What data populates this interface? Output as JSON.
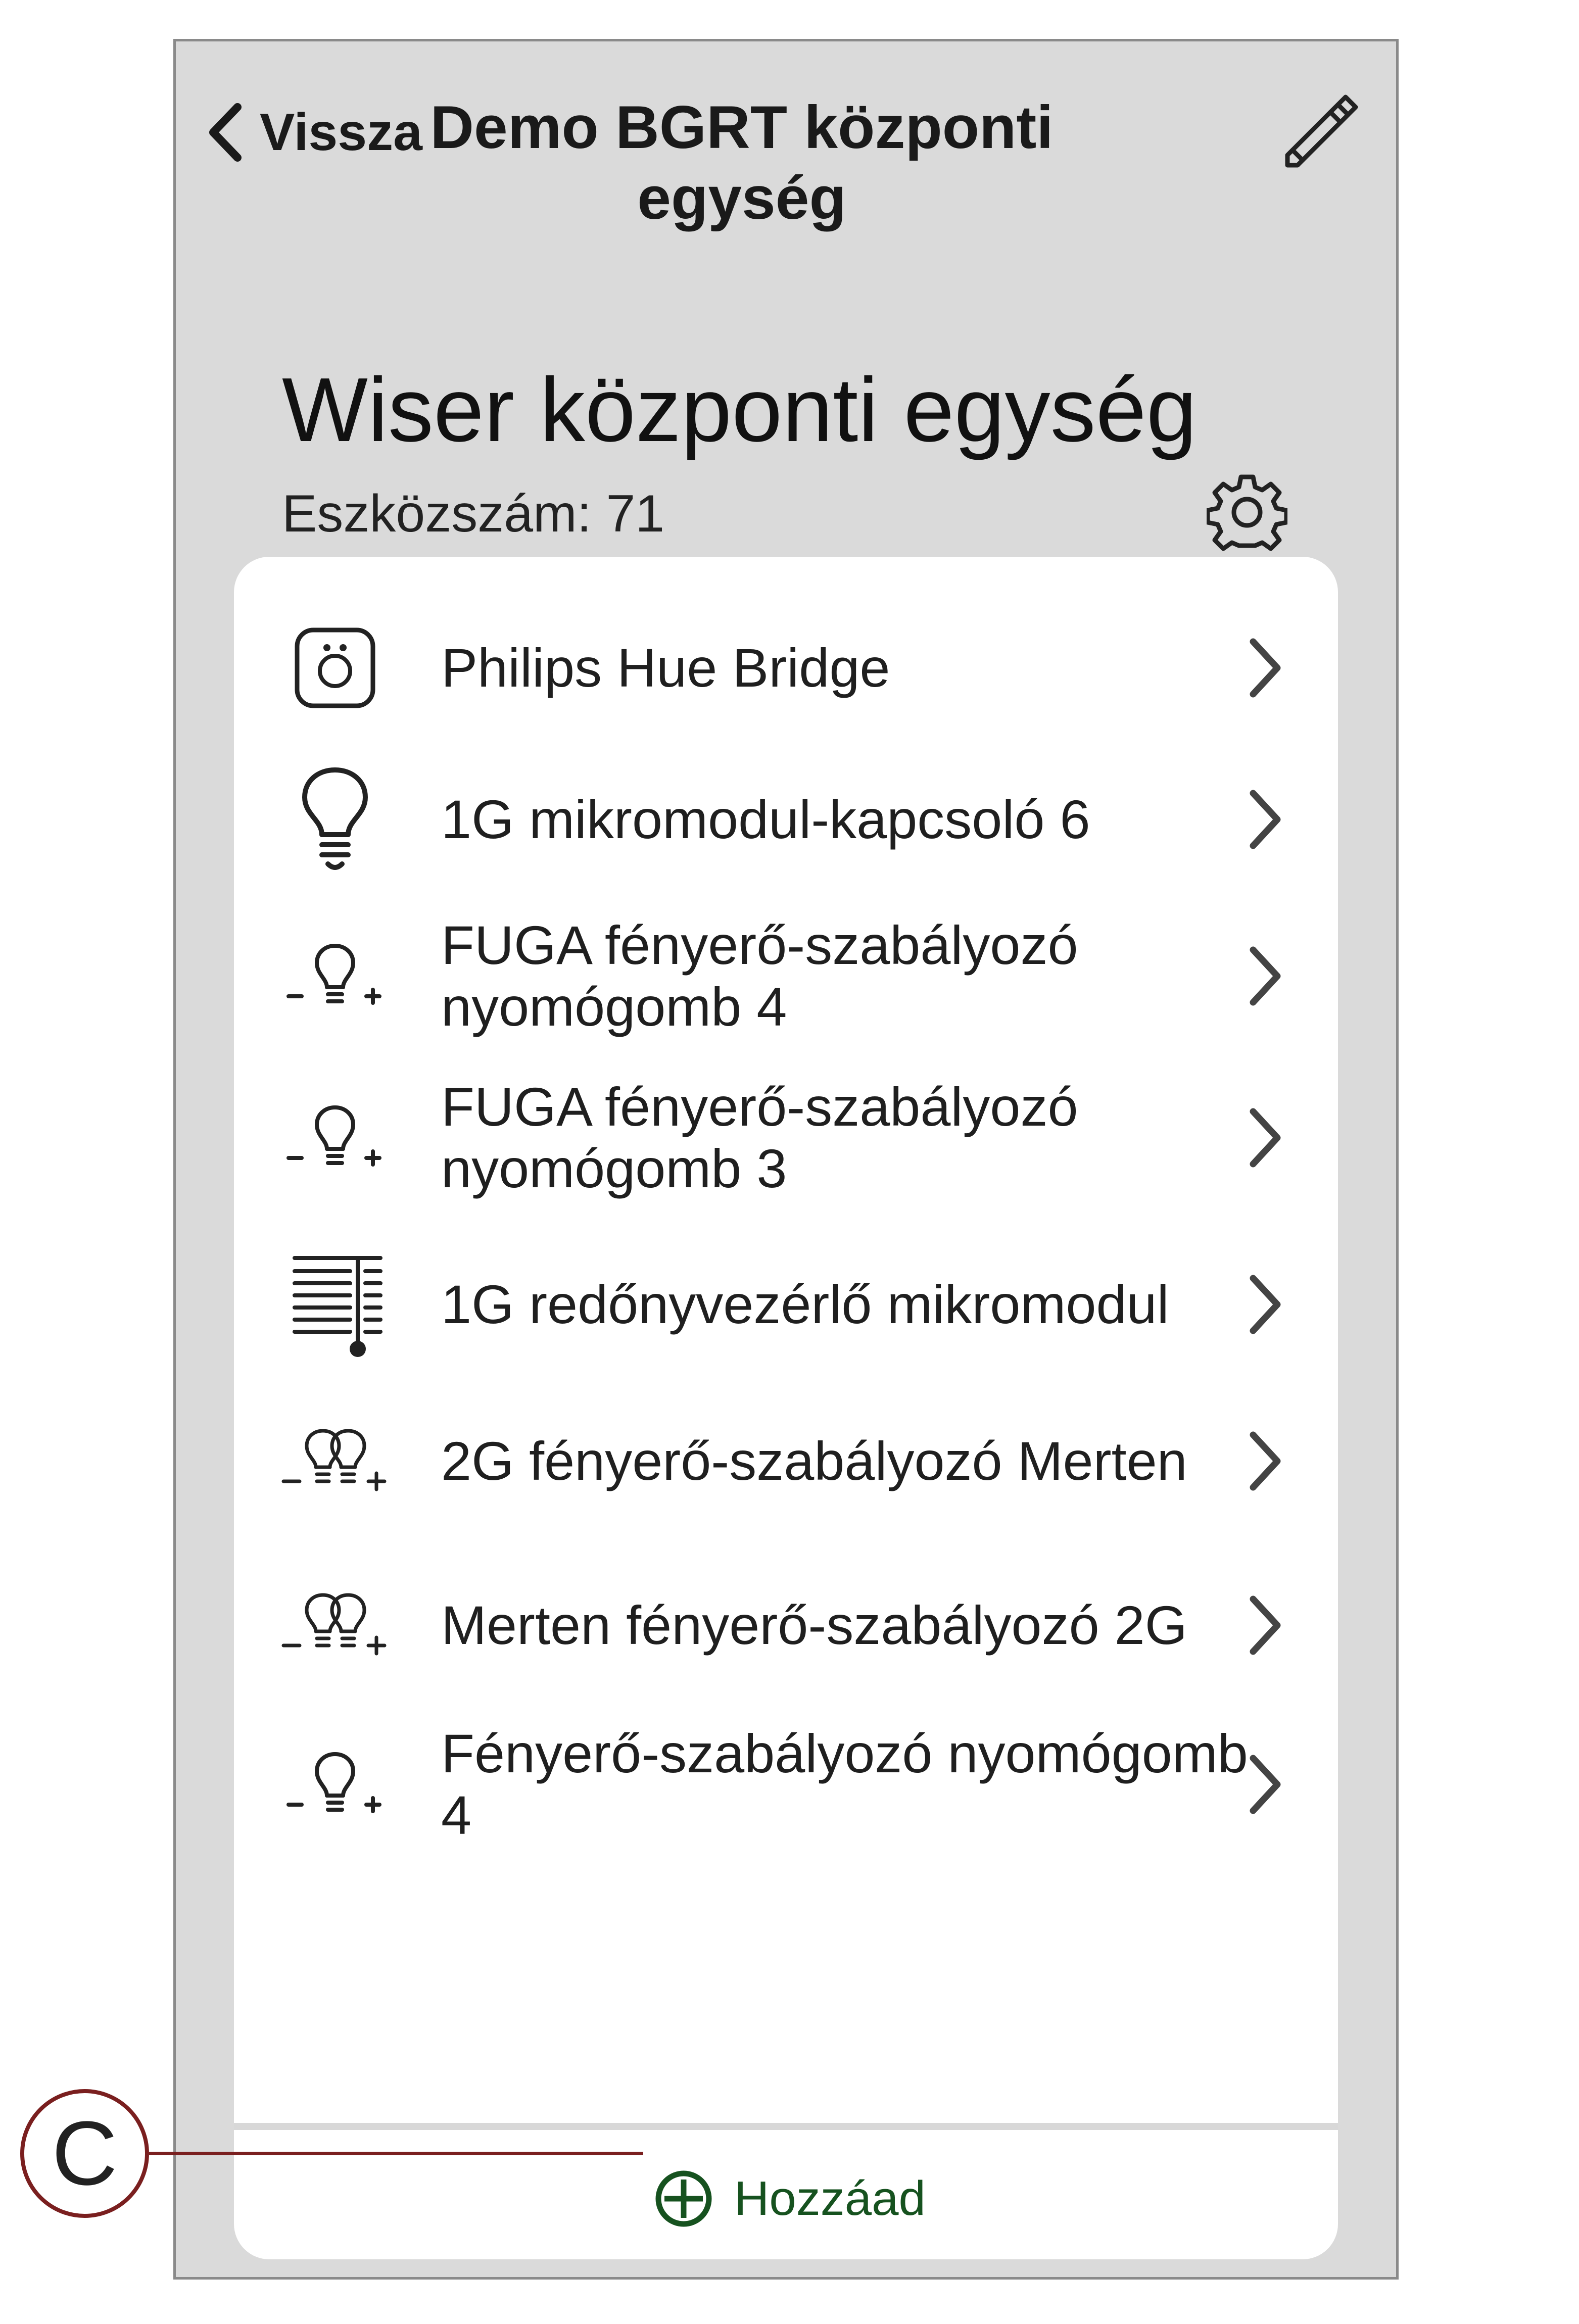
{
  "header": {
    "back_label": "Vissza",
    "title": "Demo BGRT központi egység",
    "edit_icon": "pencil-icon",
    "back_icon": "chevron-left-icon"
  },
  "section": {
    "title": "Wiser központi egység",
    "subtitle": "Eszközszám: 71",
    "settings_icon": "gear-icon"
  },
  "devices": [
    {
      "label": "Philips Hue Bridge",
      "icon": "hue-bridge-icon"
    },
    {
      "label": "1G mikromodul-kapcsoló 6",
      "icon": "bulb-icon"
    },
    {
      "label": "FUGA fényerő-szabályozó nyomógomb 4",
      "icon": "dimmer-bulb-icon"
    },
    {
      "label": "FUGA fényerő-szabályozó nyomógomb 3",
      "icon": "dimmer-bulb-icon"
    },
    {
      "label": "1G redőnyvezérlő mikromodul",
      "icon": "shutter-icon"
    },
    {
      "label": "2G fényerő-szabályozó Merten",
      "icon": "double-dimmer-bulb-icon"
    },
    {
      "label": "Merten fényerő-szabályozó 2G",
      "icon": "double-dimmer-bulb-icon"
    },
    {
      "label": "Fényerő-szabályozó nyomógomb 4",
      "icon": "dimmer-bulb-icon"
    }
  ],
  "add": {
    "label": "Hozzáad",
    "icon": "plus-circle-icon"
  },
  "callout": {
    "letter": "C"
  },
  "colors": {
    "screen_bg": "#dadada",
    "card_bg": "#ffffff",
    "add_green": "#16521f",
    "callout": "#7a1f1f"
  }
}
